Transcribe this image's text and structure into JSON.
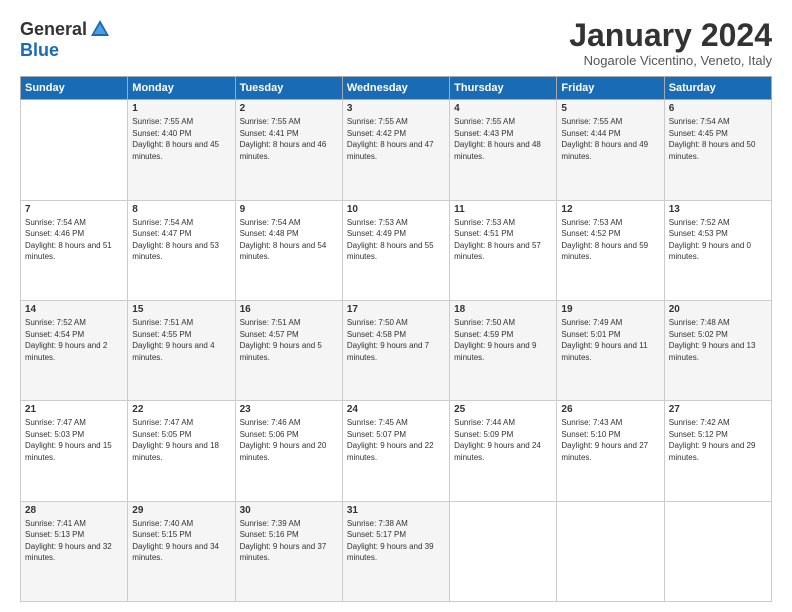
{
  "logo": {
    "general": "General",
    "blue": "Blue"
  },
  "header": {
    "title": "January 2024",
    "location": "Nogarole Vicentino, Veneto, Italy"
  },
  "weekdays": [
    "Sunday",
    "Monday",
    "Tuesday",
    "Wednesday",
    "Thursday",
    "Friday",
    "Saturday"
  ],
  "weeks": [
    [
      {
        "day": "",
        "sunrise": "",
        "sunset": "",
        "daylight": ""
      },
      {
        "day": "1",
        "sunrise": "Sunrise: 7:55 AM",
        "sunset": "Sunset: 4:40 PM",
        "daylight": "Daylight: 8 hours and 45 minutes."
      },
      {
        "day": "2",
        "sunrise": "Sunrise: 7:55 AM",
        "sunset": "Sunset: 4:41 PM",
        "daylight": "Daylight: 8 hours and 46 minutes."
      },
      {
        "day": "3",
        "sunrise": "Sunrise: 7:55 AM",
        "sunset": "Sunset: 4:42 PM",
        "daylight": "Daylight: 8 hours and 47 minutes."
      },
      {
        "day": "4",
        "sunrise": "Sunrise: 7:55 AM",
        "sunset": "Sunset: 4:43 PM",
        "daylight": "Daylight: 8 hours and 48 minutes."
      },
      {
        "day": "5",
        "sunrise": "Sunrise: 7:55 AM",
        "sunset": "Sunset: 4:44 PM",
        "daylight": "Daylight: 8 hours and 49 minutes."
      },
      {
        "day": "6",
        "sunrise": "Sunrise: 7:54 AM",
        "sunset": "Sunset: 4:45 PM",
        "daylight": "Daylight: 8 hours and 50 minutes."
      }
    ],
    [
      {
        "day": "7",
        "sunrise": "Sunrise: 7:54 AM",
        "sunset": "Sunset: 4:46 PM",
        "daylight": "Daylight: 8 hours and 51 minutes."
      },
      {
        "day": "8",
        "sunrise": "Sunrise: 7:54 AM",
        "sunset": "Sunset: 4:47 PM",
        "daylight": "Daylight: 8 hours and 53 minutes."
      },
      {
        "day": "9",
        "sunrise": "Sunrise: 7:54 AM",
        "sunset": "Sunset: 4:48 PM",
        "daylight": "Daylight: 8 hours and 54 minutes."
      },
      {
        "day": "10",
        "sunrise": "Sunrise: 7:53 AM",
        "sunset": "Sunset: 4:49 PM",
        "daylight": "Daylight: 8 hours and 55 minutes."
      },
      {
        "day": "11",
        "sunrise": "Sunrise: 7:53 AM",
        "sunset": "Sunset: 4:51 PM",
        "daylight": "Daylight: 8 hours and 57 minutes."
      },
      {
        "day": "12",
        "sunrise": "Sunrise: 7:53 AM",
        "sunset": "Sunset: 4:52 PM",
        "daylight": "Daylight: 8 hours and 59 minutes."
      },
      {
        "day": "13",
        "sunrise": "Sunrise: 7:52 AM",
        "sunset": "Sunset: 4:53 PM",
        "daylight": "Daylight: 9 hours and 0 minutes."
      }
    ],
    [
      {
        "day": "14",
        "sunrise": "Sunrise: 7:52 AM",
        "sunset": "Sunset: 4:54 PM",
        "daylight": "Daylight: 9 hours and 2 minutes."
      },
      {
        "day": "15",
        "sunrise": "Sunrise: 7:51 AM",
        "sunset": "Sunset: 4:55 PM",
        "daylight": "Daylight: 9 hours and 4 minutes."
      },
      {
        "day": "16",
        "sunrise": "Sunrise: 7:51 AM",
        "sunset": "Sunset: 4:57 PM",
        "daylight": "Daylight: 9 hours and 5 minutes."
      },
      {
        "day": "17",
        "sunrise": "Sunrise: 7:50 AM",
        "sunset": "Sunset: 4:58 PM",
        "daylight": "Daylight: 9 hours and 7 minutes."
      },
      {
        "day": "18",
        "sunrise": "Sunrise: 7:50 AM",
        "sunset": "Sunset: 4:59 PM",
        "daylight": "Daylight: 9 hours and 9 minutes."
      },
      {
        "day": "19",
        "sunrise": "Sunrise: 7:49 AM",
        "sunset": "Sunset: 5:01 PM",
        "daylight": "Daylight: 9 hours and 11 minutes."
      },
      {
        "day": "20",
        "sunrise": "Sunrise: 7:48 AM",
        "sunset": "Sunset: 5:02 PM",
        "daylight": "Daylight: 9 hours and 13 minutes."
      }
    ],
    [
      {
        "day": "21",
        "sunrise": "Sunrise: 7:47 AM",
        "sunset": "Sunset: 5:03 PM",
        "daylight": "Daylight: 9 hours and 15 minutes."
      },
      {
        "day": "22",
        "sunrise": "Sunrise: 7:47 AM",
        "sunset": "Sunset: 5:05 PM",
        "daylight": "Daylight: 9 hours and 18 minutes."
      },
      {
        "day": "23",
        "sunrise": "Sunrise: 7:46 AM",
        "sunset": "Sunset: 5:06 PM",
        "daylight": "Daylight: 9 hours and 20 minutes."
      },
      {
        "day": "24",
        "sunrise": "Sunrise: 7:45 AM",
        "sunset": "Sunset: 5:07 PM",
        "daylight": "Daylight: 9 hours and 22 minutes."
      },
      {
        "day": "25",
        "sunrise": "Sunrise: 7:44 AM",
        "sunset": "Sunset: 5:09 PM",
        "daylight": "Daylight: 9 hours and 24 minutes."
      },
      {
        "day": "26",
        "sunrise": "Sunrise: 7:43 AM",
        "sunset": "Sunset: 5:10 PM",
        "daylight": "Daylight: 9 hours and 27 minutes."
      },
      {
        "day": "27",
        "sunrise": "Sunrise: 7:42 AM",
        "sunset": "Sunset: 5:12 PM",
        "daylight": "Daylight: 9 hours and 29 minutes."
      }
    ],
    [
      {
        "day": "28",
        "sunrise": "Sunrise: 7:41 AM",
        "sunset": "Sunset: 5:13 PM",
        "daylight": "Daylight: 9 hours and 32 minutes."
      },
      {
        "day": "29",
        "sunrise": "Sunrise: 7:40 AM",
        "sunset": "Sunset: 5:15 PM",
        "daylight": "Daylight: 9 hours and 34 minutes."
      },
      {
        "day": "30",
        "sunrise": "Sunrise: 7:39 AM",
        "sunset": "Sunset: 5:16 PM",
        "daylight": "Daylight: 9 hours and 37 minutes."
      },
      {
        "day": "31",
        "sunrise": "Sunrise: 7:38 AM",
        "sunset": "Sunset: 5:17 PM",
        "daylight": "Daylight: 9 hours and 39 minutes."
      },
      {
        "day": "",
        "sunrise": "",
        "sunset": "",
        "daylight": ""
      },
      {
        "day": "",
        "sunrise": "",
        "sunset": "",
        "daylight": ""
      },
      {
        "day": "",
        "sunrise": "",
        "sunset": "",
        "daylight": ""
      }
    ]
  ]
}
